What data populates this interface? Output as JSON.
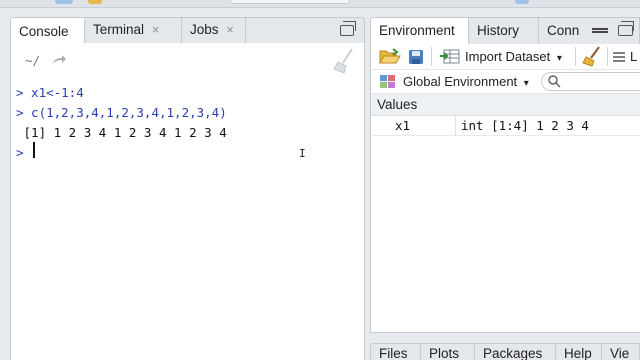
{
  "console_pane": {
    "tabs": [
      {
        "label": "Console",
        "closable": false
      },
      {
        "label": "Terminal",
        "closable": true
      },
      {
        "label": "Jobs",
        "closable": true
      }
    ],
    "close_glyph": "×",
    "path": "~/",
    "lines": [
      {
        "kind": "cmd",
        "text": "> x1<-1:4"
      },
      {
        "kind": "cmd",
        "text": "> c(1,2,3,4,1,2,3,4,1,2,3,4)"
      },
      {
        "kind": "out",
        "text": " [1] 1 2 3 4 1 2 3 4 1 2 3 4"
      },
      {
        "kind": "cmd",
        "text": "> "
      }
    ],
    "text_cursor_glyph": "I"
  },
  "env_pane": {
    "tabs": [
      "Environment",
      "History",
      "Conn"
    ],
    "toolbar": {
      "import_label": "Import Dataset",
      "dropdown_glyph": "▾",
      "trailing_letter": "L"
    },
    "scope": {
      "label": "Global Environment",
      "dropdown_glyph": "▾"
    },
    "section": "Values",
    "variables": [
      {
        "name": "x1",
        "value": "int [1:4] 1 2 3 4"
      }
    ]
  },
  "bottom_pane": {
    "tabs": [
      "Files",
      "Plots",
      "Packages",
      "Help",
      "Vie"
    ]
  },
  "colors": {
    "command": "#2b3fae",
    "output": "#111111",
    "accent_green": "#3c8c3c"
  }
}
